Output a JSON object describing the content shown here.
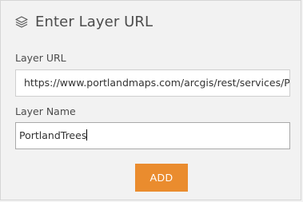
{
  "header": {
    "title": "Enter Layer URL",
    "icon": "layers-icon"
  },
  "form": {
    "url_label": "Layer URL",
    "url_value": "https://www.portlandmaps.com/arcgis/rest/services/Publi",
    "name_label": "Layer Name",
    "name_value": "PortlandTrees"
  },
  "actions": {
    "add_label": "ADD"
  },
  "colors": {
    "accent": "#ea8c2e",
    "background": "#f2f2f2"
  }
}
